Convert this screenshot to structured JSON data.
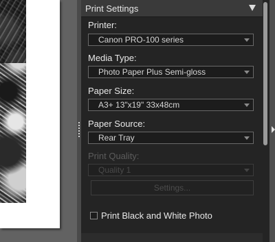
{
  "panel": {
    "title": "Print Settings",
    "collapse_icon": "triangle-down-icon"
  },
  "printer": {
    "label": "Printer:",
    "value": "Canon PRO-100 series"
  },
  "media_type": {
    "label": "Media Type:",
    "value": "Photo Paper Plus Semi-gloss"
  },
  "paper_size": {
    "label": "Paper Size:",
    "value": "A3+ 13\"x19\" 33x48cm"
  },
  "paper_source": {
    "label": "Paper Source:",
    "value": "Rear Tray"
  },
  "print_quality": {
    "label": "Print Quality:",
    "value": "Quality 1",
    "enabled": false
  },
  "settings_button": {
    "label": "Settings...",
    "enabled": false
  },
  "bw_checkbox": {
    "label": "Print Black and White Photo",
    "checked": false
  },
  "colors": {
    "panel_bg": "#242424",
    "header_bg": "#3a3a3a",
    "text": "#e8e8e8",
    "disabled_text": "#5c5c5c"
  }
}
